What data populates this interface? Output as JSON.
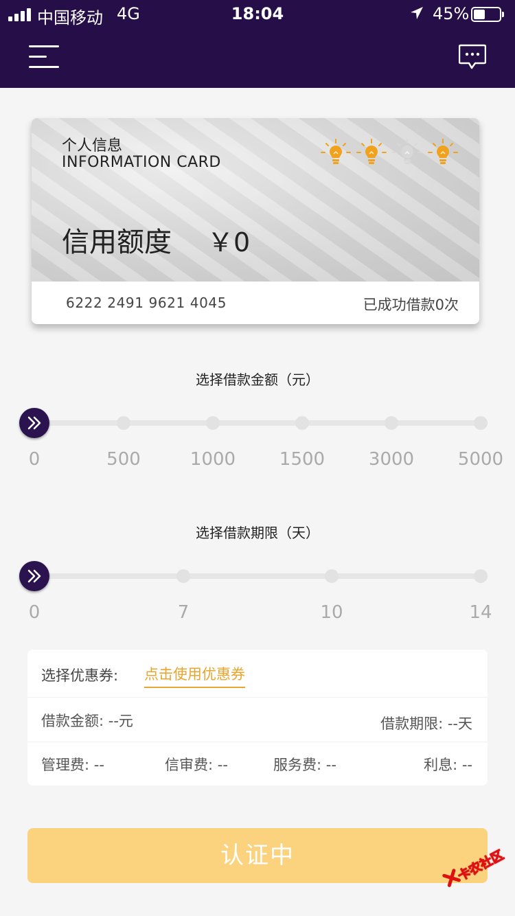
{
  "status_bar": {
    "carrier": "中国移动",
    "network": "4G",
    "time": "18:04",
    "battery_percent": "45%",
    "battery_level": 0.45
  },
  "nav": {
    "menu_icon": "menu-icon",
    "message_icon": "message-icon"
  },
  "card": {
    "title": "个人信息",
    "subtitle": "INFORMATION CARD",
    "credit_label": "信用额度",
    "credit_value": "￥0",
    "card_number": "6222 2491 9621 4045",
    "loan_count_text": "已成功借款0次",
    "bulbs": [
      {
        "icon": "lightbulb-icon",
        "lit": true
      },
      {
        "icon": "lightbulb-icon",
        "lit": true
      },
      {
        "icon": "lightbulb-icon",
        "lit": false
      },
      {
        "icon": "lightbulb-icon",
        "lit": true
      }
    ]
  },
  "amount_slider": {
    "title": "选择借款金额（元）",
    "ticks": [
      "0",
      "500",
      "1000",
      "1500",
      "3000",
      "5000"
    ],
    "selected_index": 0
  },
  "term_slider": {
    "title": "选择借款期限（天）",
    "ticks": [
      "0",
      "7",
      "10",
      "14"
    ],
    "selected_index": 0
  },
  "summary": {
    "coupon_label": "选择优惠券:",
    "coupon_link": "点击使用优惠券",
    "amount": "借款金额: --元",
    "term": "借款期限: --天",
    "management_fee": "管理费: --",
    "review_fee": "信审费: --",
    "service_fee": "服务费: --",
    "interest": "利息: --"
  },
  "submit_button": {
    "label": "认证中"
  },
  "watermark": {
    "text": "卡农社区"
  },
  "colors": {
    "header_bg": "#260e48",
    "accent": "#e9a62e",
    "button_bg": "#fbd27e",
    "thumb": "#2b1350",
    "bulb_on": "#f0a21c",
    "bulb_off": "#d8d8d8"
  }
}
